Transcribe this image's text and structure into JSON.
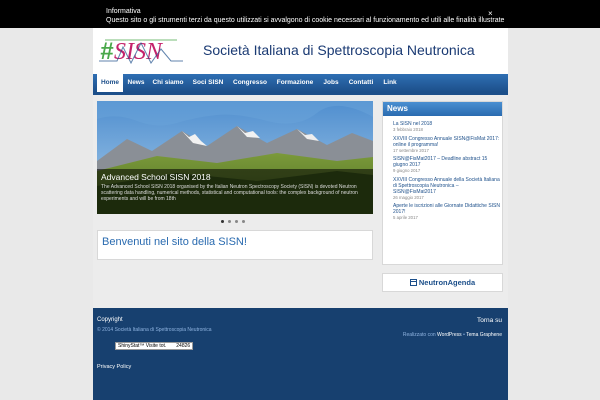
{
  "cookie": {
    "title": "Informativa",
    "text": "Questo sito o gli strumenti terzi da questo utilizzati si avvalgono di cookie necessari al funzionamento ed utili alle finalità illustrate",
    "close": "×"
  },
  "header": {
    "logo_text": "#SISN",
    "site_title": "Società Italiana di Spettroscopia Neutronica"
  },
  "nav": {
    "items": [
      "Home",
      "News",
      "Chi siamo",
      "Soci SISN",
      "Congresso",
      "Formazione",
      "Jobs",
      "Contatti",
      "Link"
    ],
    "active": "Home"
  },
  "slider": {
    "title": "Advanced School SISN 2018",
    "text": "The Advanced School SISN 2018 organised by the Italian Neutron Spectroscopy Society (SISN) is devoted Neutron scattering data handling, numerical methods, statistical and computational tools: the complex background of neutron experiments and will be from 18th"
  },
  "welcome": {
    "heading": "Benvenuti nel sito della SISN!"
  },
  "news": {
    "heading": "News",
    "items": [
      {
        "title": "La SISN nel 2018",
        "date": "3 febbraio 2018"
      },
      {
        "title": "XXVIII Congresso Annuale SISN@FisMat 2017: online il programma!",
        "date": "17 settembre 2017"
      },
      {
        "title": "SISN@FisMat2017 – Deadline abstract 15 giugno 2017",
        "date": "9 giugno 2017"
      },
      {
        "title": "XXVIII Congresso Annuale della Società Italiana di Spettroscopia Neutronica – SISN@FisMat2017",
        "date": "26 maggio 2017"
      },
      {
        "title": "Aperte le iscrizioni alle Giornate Didattiche SISN 2017!",
        "date": "5 aprile 2017"
      }
    ]
  },
  "agenda": {
    "label": "NeutronAgenda"
  },
  "footer": {
    "copyright": "Copyright",
    "to_top": "Torna su",
    "copyright_line": "© 2014 Società Italiana di Spettroscopia Neutronica",
    "credit_prefix": "Realizzato con",
    "credit_wp": "WordPress",
    "credit_sep": "•",
    "credit_theme": "Tema Graphene",
    "counter_label": "ShinyStat™ Visite tot.",
    "counter_value": "24826",
    "privacy": "Privacy Policy"
  },
  "colors": {
    "nav": "#1c4f8a",
    "footer": "#17406f",
    "accent": "#2a6bb0"
  }
}
